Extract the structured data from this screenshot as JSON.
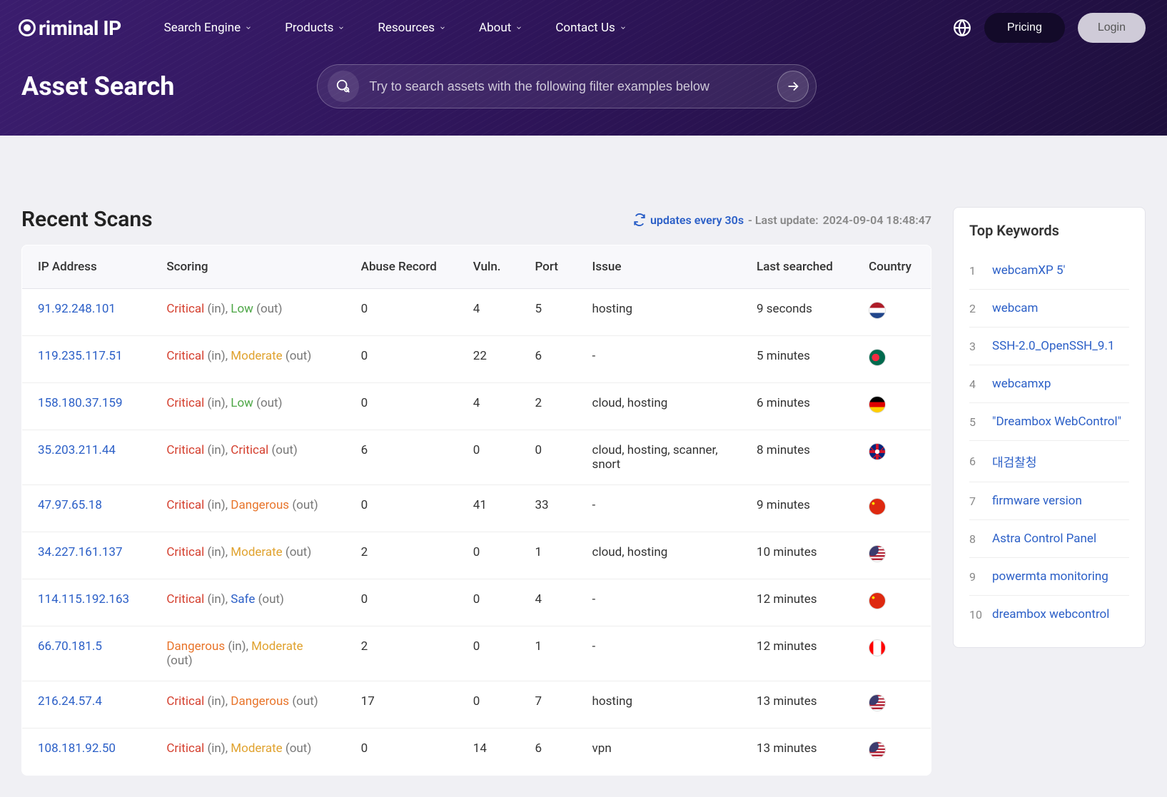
{
  "brand": "riminal IP",
  "nav": [
    "Search Engine",
    "Products",
    "Resources",
    "About",
    "Contact Us"
  ],
  "pricing": "Pricing",
  "login": "Login",
  "page_title": "Asset Search",
  "search_placeholder": "Try to search assets with the following filter examples below",
  "section_title": "Recent Scans",
  "update_label": "updates every 30s",
  "last_update_prefix": " - Last update: ",
  "last_update": "2024-09-04 18:48:47",
  "columns": [
    "IP Address",
    "Scoring",
    "Abuse Record",
    "Vuln.",
    "Port",
    "Issue",
    "Last searched",
    "Country"
  ],
  "rows": [
    {
      "ip": "91.92.248.101",
      "in": "Critical",
      "out": "Low",
      "abuse": "0",
      "vuln": "4",
      "port": "5",
      "issue": "hosting",
      "last": "9 seconds",
      "flag": "nl"
    },
    {
      "ip": "119.235.117.51",
      "in": "Critical",
      "out": "Moderate",
      "abuse": "0",
      "vuln": "22",
      "port": "6",
      "issue": "-",
      "last": "5 minutes",
      "flag": "bd"
    },
    {
      "ip": "158.180.37.159",
      "in": "Critical",
      "out": "Low",
      "abuse": "0",
      "vuln": "4",
      "port": "2",
      "issue": "cloud, hosting",
      "last": "6 minutes",
      "flag": "de"
    },
    {
      "ip": "35.203.211.44",
      "in": "Critical",
      "out": "Critical",
      "abuse": "6",
      "vuln": "0",
      "port": "0",
      "issue": "cloud, hosting, scanner, snort",
      "last": "8 minutes",
      "flag": "gb"
    },
    {
      "ip": "47.97.65.18",
      "in": "Critical",
      "out": "Dangerous",
      "abuse": "0",
      "vuln": "41",
      "port": "33",
      "issue": "-",
      "last": "9 minutes",
      "flag": "cn"
    },
    {
      "ip": "34.227.161.137",
      "in": "Critical",
      "out": "Moderate",
      "abuse": "2",
      "vuln": "0",
      "port": "1",
      "issue": "cloud, hosting",
      "last": "10 minutes",
      "flag": "us"
    },
    {
      "ip": "114.115.192.163",
      "in": "Critical",
      "out": "Safe",
      "abuse": "0",
      "vuln": "0",
      "port": "4",
      "issue": "-",
      "last": "12 minutes",
      "flag": "cn"
    },
    {
      "ip": "66.70.181.5",
      "in": "Dangerous",
      "out": "Moderate",
      "abuse": "2",
      "vuln": "0",
      "port": "1",
      "issue": "-",
      "last": "12 minutes",
      "flag": "ca"
    },
    {
      "ip": "216.24.57.4",
      "in": "Critical",
      "out": "Dangerous",
      "abuse": "17",
      "vuln": "0",
      "port": "7",
      "issue": "hosting",
      "last": "13 minutes",
      "flag": "us"
    },
    {
      "ip": "108.181.92.50",
      "in": "Critical",
      "out": "Moderate",
      "abuse": "0",
      "vuln": "14",
      "port": "6",
      "issue": "vpn",
      "last": "13 minutes",
      "flag": "us"
    }
  ],
  "flags": {
    "nl": "linear-gradient(to bottom, #ae1c28 33%, #fff 33%, #fff 66%, #21468b 66%)",
    "bd": "radial-gradient(circle at 40% 50%, #f42a41 0%, #f42a41 30%, #006a4e 31%)",
    "de": "linear-gradient(to bottom, #000 33%, #dd0000 33%, #dd0000 66%, #ffce00 66%)",
    "gb": "radial-gradient(circle, #fff 0%, #fff 20%, transparent 21%), linear-gradient(45deg, transparent 40%, #cf142b 40%, #cf142b 45%, transparent 45%), linear-gradient(-45deg, transparent 40%, #cf142b 40%, #cf142b 45%, transparent 45%), linear-gradient(to bottom, transparent 40%, #cf142b 40%, #cf142b 60%, transparent 60%), linear-gradient(to right, transparent 40%, #cf142b 40%, #cf142b 60%, transparent 60%), #00247d",
    "cn": "radial-gradient(circle at 25% 30%, #ffde00 0%, #ffde00 8%, transparent 9%), #de2910",
    "us": "radial-gradient(circle at 20% 25%, #3c3b6e 0%, #3c3b6e 35%, transparent 36%), repeating-linear-gradient(to bottom, #b22234 0%, #b22234 10%, #fff 10%, #fff 20%)",
    "ca": "linear-gradient(to right, #ff0000 25%, #fff 25%, #fff 75%, #ff0000 75%)"
  },
  "score_class": {
    "Critical": "score-critical",
    "Dangerous": "score-dangerous",
    "Moderate": "score-moderate",
    "Low": "score-low",
    "Safe": "score-safe"
  },
  "sidebar_title": "Top Keywords",
  "keywords": [
    "webcamXP 5'",
    "webcam",
    "SSH-2.0_OpenSSH_9.1",
    "webcamxp",
    "\"Dreambox WebControl\"",
    "대검찰청",
    "firmware version",
    "Astra Control Panel",
    "powermta monitoring",
    "dreambox webcontrol"
  ]
}
